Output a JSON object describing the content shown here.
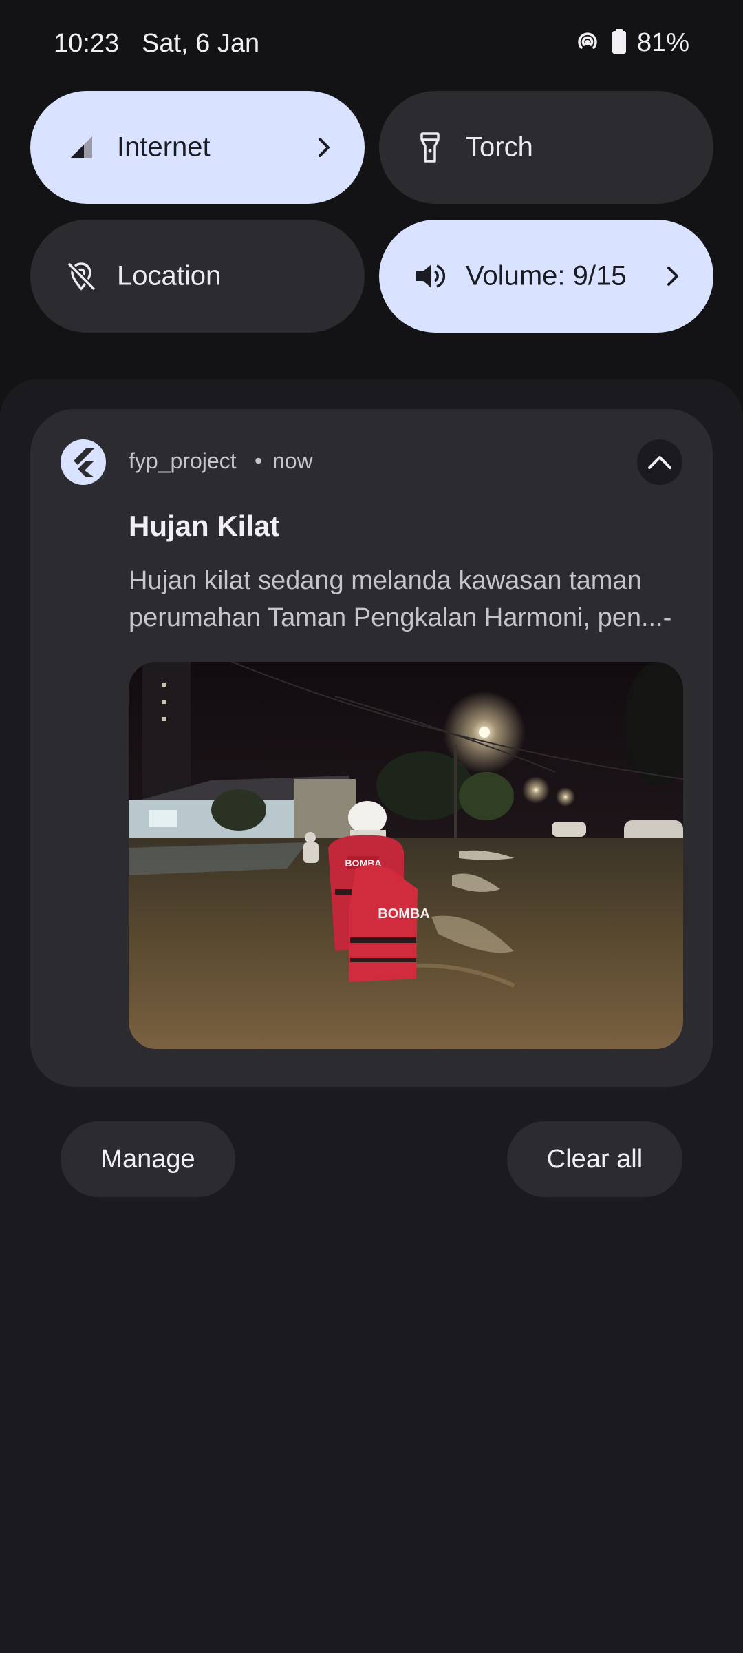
{
  "status_bar": {
    "time": "10:23",
    "date": "Sat, 6 Jan",
    "hotspot_icon": "hotspot-icon",
    "battery_icon": "battery-icon",
    "battery_percent": "81%"
  },
  "quick_settings": {
    "tiles": [
      {
        "label": "Internet",
        "icon": "signal-icon",
        "active": true,
        "has_chevron": true
      },
      {
        "label": "Torch",
        "icon": "torch-icon",
        "active": false,
        "has_chevron": false
      },
      {
        "label": "Location",
        "icon": "location-off-icon",
        "active": false,
        "has_chevron": false
      },
      {
        "label": "Volume: 9/15",
        "icon": "volume-icon",
        "active": true,
        "has_chevron": true
      }
    ]
  },
  "notification": {
    "app_name": "fyp_project",
    "separator": "•",
    "time": "now",
    "title": "Hujan Kilat",
    "body": "Hujan kilat sedang melanda kawasan taman perumahan Taman Pengkalan Harmoni, pen...-",
    "image": "flood-rescue-photo"
  },
  "actions": {
    "manage_label": "Manage",
    "clear_all_label": "Clear all"
  },
  "colors": {
    "background": "#131316",
    "shade": "#1b1b1f",
    "card": "#2c2c30",
    "tile_active": "#d9e2fe"
  }
}
